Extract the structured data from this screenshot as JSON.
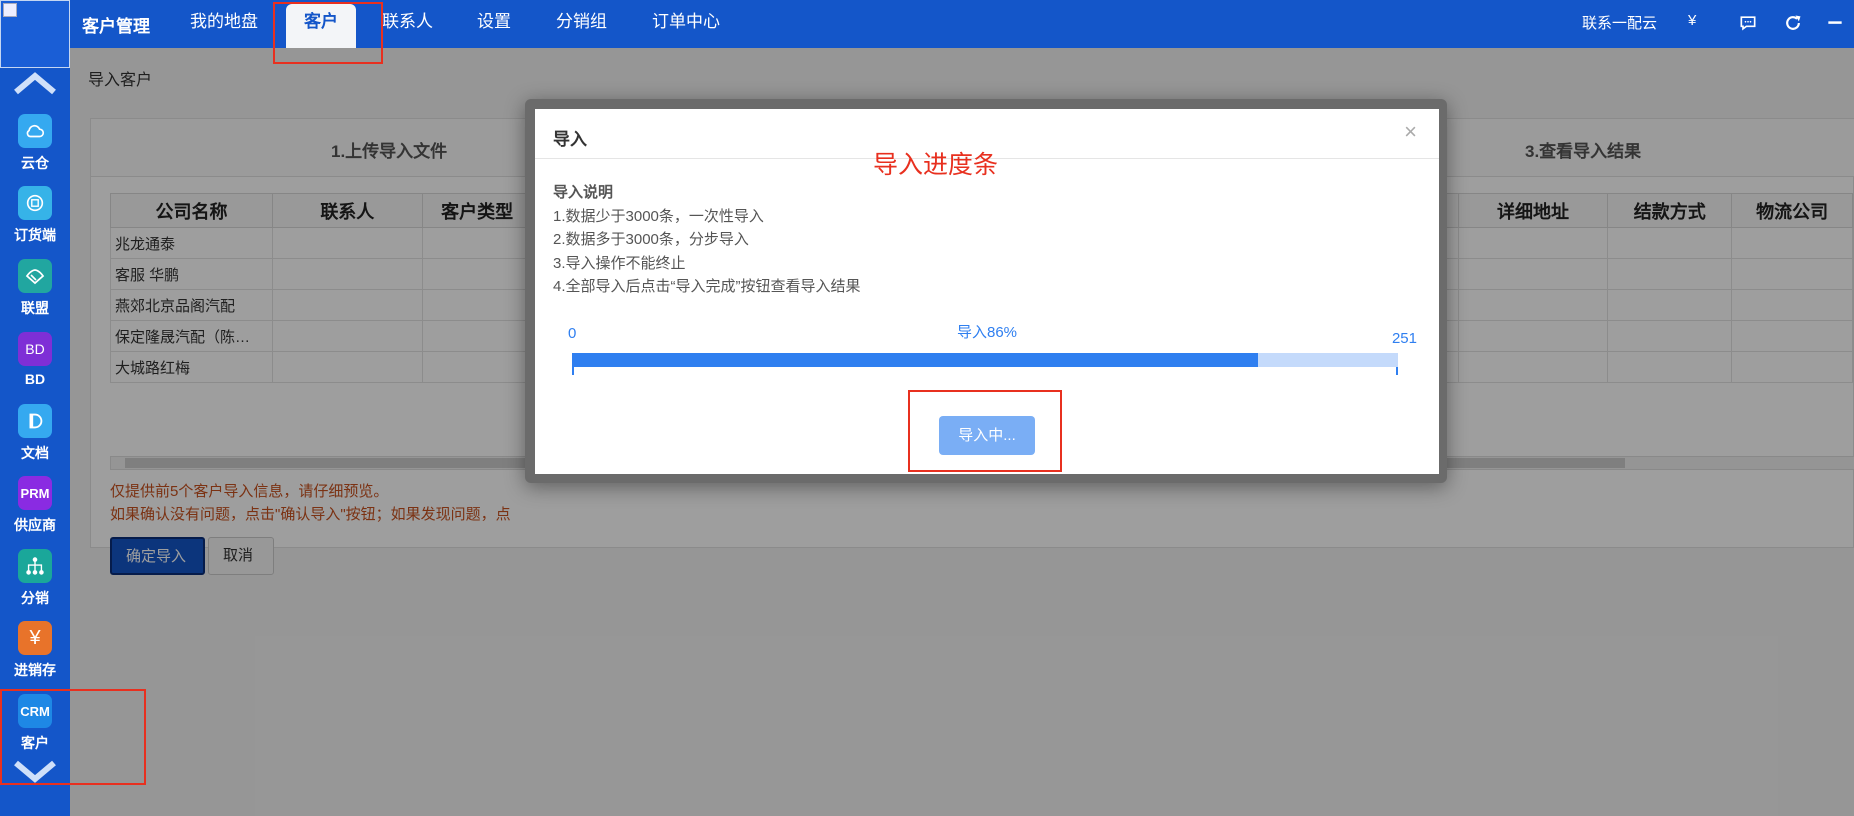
{
  "rail": {
    "items": [
      {
        "label": "云仓",
        "icon": "cloud-icon",
        "color": "#35a9f0"
      },
      {
        "label": "订货端",
        "icon": "order-icon",
        "color": "#36b3e8"
      },
      {
        "label": "联盟",
        "icon": "handshake-icon",
        "color": "#21a6a0",
        "glyph": ""
      },
      {
        "label": "BD",
        "icon": "bd-icon",
        "color": "#7e2fd6",
        "glyph": "BD"
      },
      {
        "label": "文档",
        "icon": "document-icon",
        "color": "#35a9f0",
        "glyph": ""
      },
      {
        "label": "供应商",
        "icon": "prm-icon",
        "color": "#8a2be2",
        "glyph": "PRM"
      },
      {
        "label": "分销",
        "icon": "distribution-icon",
        "color": "#1aa79a",
        "glyph": ""
      },
      {
        "label": "进销存",
        "icon": "yen-icon",
        "color": "#e8732a",
        "glyph": "¥"
      },
      {
        "label": "客户",
        "icon": "crm-icon",
        "color": "#1e88e5",
        "glyph": "CRM"
      }
    ]
  },
  "topbar": {
    "brand": "客户管理",
    "tabs": [
      "我的地盘",
      "客户",
      "联系人",
      "设置",
      "分销组",
      "订单中心"
    ],
    "active_tab": "客户",
    "right_text": "联系一配云",
    "currency_symbol": "¥"
  },
  "page": {
    "breadcrumb": "导入客户",
    "steps": [
      "1.上传导入文件",
      "3.查看导入结果"
    ],
    "table": {
      "left_headers": [
        "公司名称",
        "联系人",
        "客户类型"
      ],
      "right_headers": [
        "详细地址",
        "结款方式",
        "物流公司"
      ],
      "rows": [
        "兆龙通泰",
        "客服 华鹏",
        "燕郊北京品阁汽配",
        "保定隆晟汽配（陈…",
        "大城路红梅"
      ]
    },
    "notes": [
      "仅提供前5个客户导入信息，请仔细预览。",
      "如果确认没有问题，点击\"确认导入\"按钮；如果发现问题，点"
    ],
    "confirm_label": "确定导入",
    "cancel_label": "取消"
  },
  "modal": {
    "title": "导入",
    "close_glyph": "×",
    "annotation": "导入进度条",
    "desc_heading": "导入说明",
    "desc_lines": [
      "1.数据少于3000条，一次性导入",
      "2.数据多于3000条，分步导入",
      "3.导入操作不能终止",
      "4.全部导入后点击“导入完成”按钮查看导入结果"
    ],
    "progress": {
      "min": "0",
      "max": "251",
      "label": "导入86%",
      "percent": 0.83
    },
    "button_label": "导入中..."
  },
  "colors": {
    "brand": "#1456c9",
    "accent": "#2f7ff0",
    "annotation": "#e8301f",
    "note": "#c7511f"
  }
}
